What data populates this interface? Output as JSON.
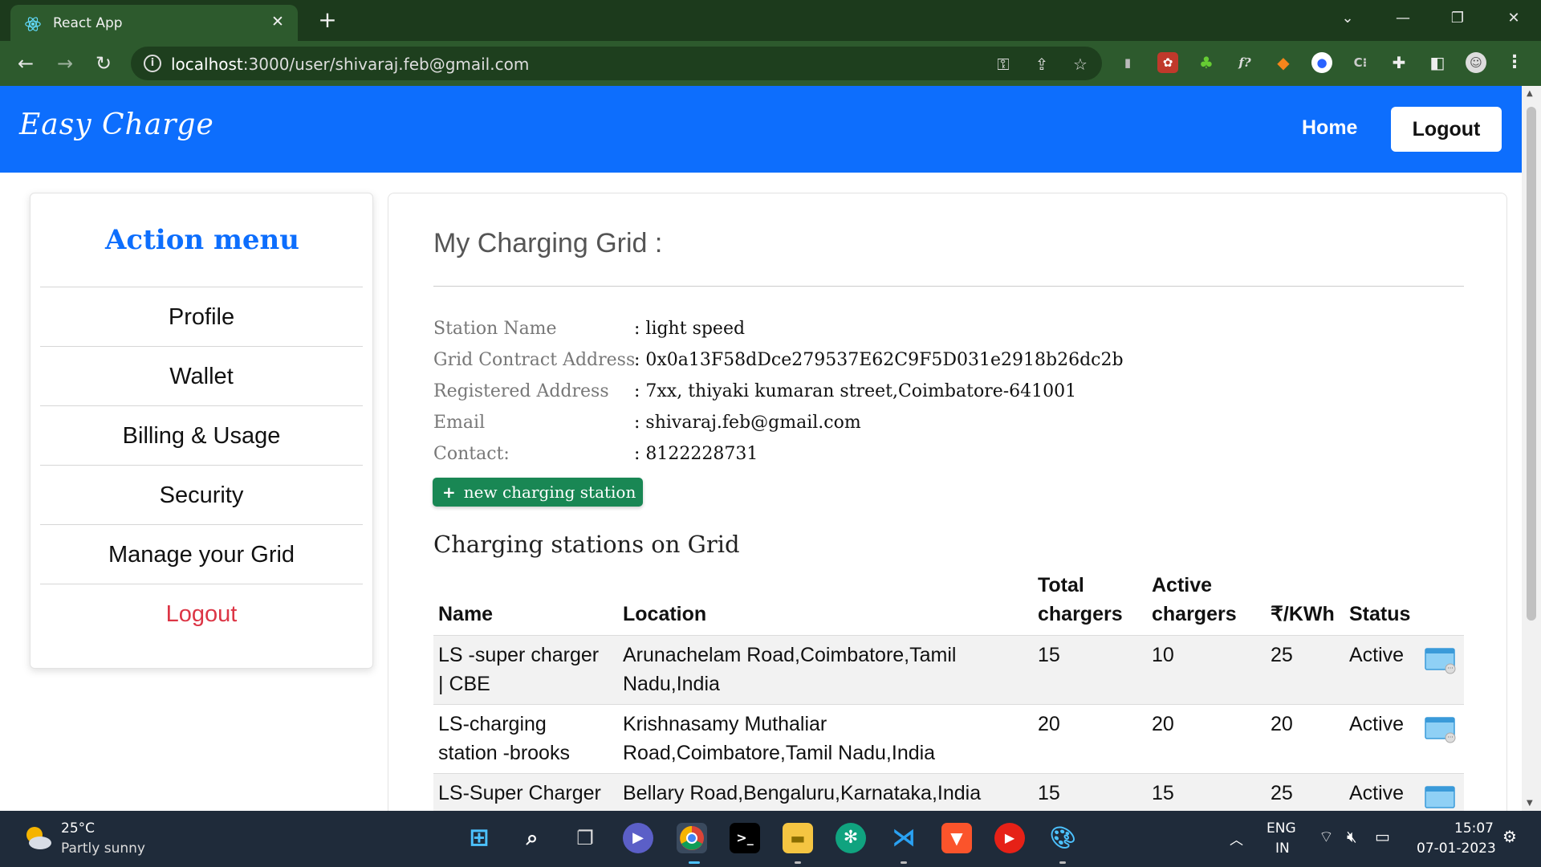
{
  "browser": {
    "tab_title": "React App",
    "url_host": "localhost",
    "url_path": ":3000/user/shivaraj.feb@gmail.com"
  },
  "navbar": {
    "brand": "Easy Charge",
    "home_label": "Home",
    "logout_label": "Logout"
  },
  "sidebar": {
    "title": "Action menu",
    "items": [
      {
        "label": "Profile"
      },
      {
        "label": "Wallet"
      },
      {
        "label": "Billing & Usage"
      },
      {
        "label": "Security"
      },
      {
        "label": "Manage your Grid"
      },
      {
        "label": "Logout"
      }
    ]
  },
  "grid": {
    "title": "My Charging Grid :",
    "fields": [
      {
        "label": "Station Name",
        "value": ": light speed"
      },
      {
        "label": "Grid Contract Address",
        "value": ": 0x0a13F58dDce279537E62C9F5D031e2918b26dc2b"
      },
      {
        "label": "Registered Address",
        "value": ": 7xx, thiyaki kumaran street,Coimbatore-641001"
      },
      {
        "label": "Email",
        "value": ": shivaraj.feb@gmail.com"
      },
      {
        "label": "Contact:",
        "value": ": 8122228731"
      }
    ],
    "new_station_button": "new charging station",
    "stations_heading": "Charging stations on Grid"
  },
  "table": {
    "headers": {
      "name": "Name",
      "location": "Location",
      "total_1": "Total",
      "total_2": "chargers",
      "active_1": "Active",
      "active_2": "chargers",
      "rate": "₹/KWh",
      "status": "Status"
    },
    "rows": [
      {
        "name_1": "LS -super charger",
        "name_2": "| CBE",
        "location_1": "Arunachelam Road,Coimbatore,Tamil",
        "location_2": "Nadu,India",
        "total": "15",
        "active": "10",
        "rate": "25",
        "status": "Active"
      },
      {
        "name_1": "LS-charging",
        "name_2": "station -brooks",
        "location_1": "Krishnasamy Muthaliar",
        "location_2": "Road,Coimbatore,Tamil Nadu,India",
        "total": "20",
        "active": "20",
        "rate": "20",
        "status": "Active"
      },
      {
        "name_1": "LS-Super Charger",
        "name_2": "",
        "location_1": "Bellary Road,Bengaluru,Karnataka,India",
        "location_2": "",
        "total": "15",
        "active": "15",
        "rate": "25",
        "status": "Active"
      }
    ]
  },
  "taskbar": {
    "weather_temp": "25°C",
    "weather_desc": "Partly sunny",
    "lang_1": "ENG",
    "lang_2": "IN",
    "time": "15:07",
    "date": "07-01-2023"
  },
  "colors": {
    "navbar": "#0d6efd",
    "success": "#198754",
    "danger": "#dc3545",
    "chrome": "#2d5a2d"
  }
}
